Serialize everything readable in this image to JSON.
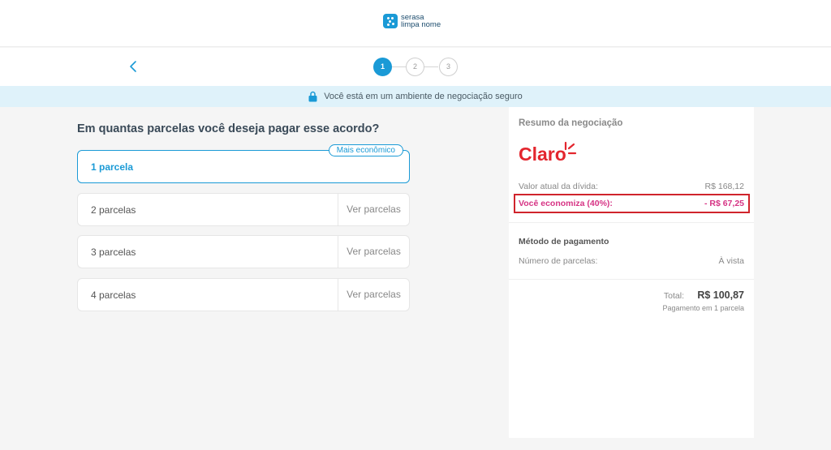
{
  "header": {
    "logo_line1": "serasa",
    "logo_line2": "limpa nome",
    "logo_icon": "serasa-logo-icon"
  },
  "steps": {
    "back_icon": "chevron-left-icon",
    "items": [
      {
        "label": "1",
        "state": "active"
      },
      {
        "label": "2",
        "state": "inactive"
      },
      {
        "label": "3",
        "state": "inactive"
      }
    ]
  },
  "secure_banner": {
    "icon": "lock-icon",
    "text": "Você está em um ambiente de negociação seguro"
  },
  "installments": {
    "question": "Em quantas parcelas você deseja pagar esse acordo?",
    "badge": "Mais econômico",
    "options": [
      {
        "label": "1 parcela",
        "link": ""
      },
      {
        "label": "2 parcelas",
        "link": "Ver parcelas"
      },
      {
        "label": "3 parcelas",
        "link": "Ver parcelas"
      },
      {
        "label": "4 parcelas",
        "link": "Ver parcelas"
      }
    ]
  },
  "summary": {
    "title": "Resumo da negociação",
    "brand": "Claro",
    "debt_label": "Valor atual da dívida:",
    "debt_value": "R$ 168,12",
    "saving_label": "Você economiza (40%):",
    "saving_value": "- R$ 67,25",
    "payment_title": "Método de pagamento",
    "installments_label": "Número de parcelas:",
    "installments_value": "À vista",
    "total_label": "Total:",
    "total_value": "R$ 100,87",
    "total_sub": "Pagamento em 1 parcela",
    "colors": {
      "brand_red": "#e3262e",
      "accent": "#1a9ad6",
      "saving": "#d63384",
      "highlight_border": "#d0242c"
    }
  }
}
